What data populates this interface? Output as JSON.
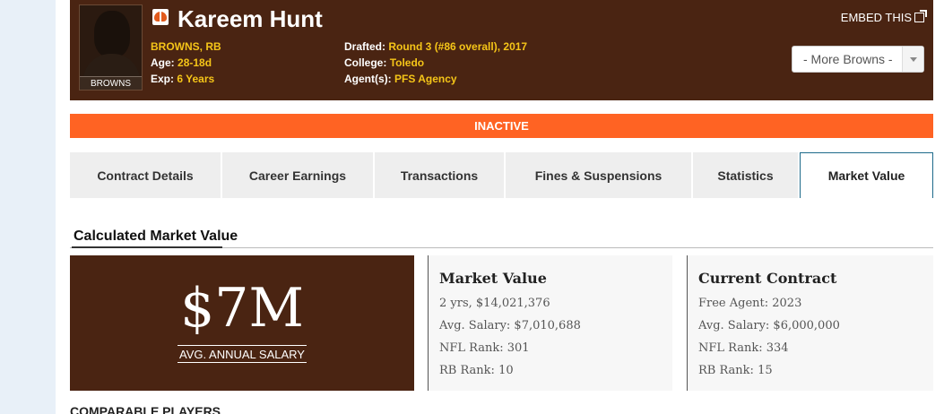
{
  "player": {
    "name": "Kareem Hunt",
    "photo_tag": "BROWNS",
    "team_position": "BROWNS, RB",
    "age_label": "Age:",
    "age_value": "28-18d",
    "exp_label": "Exp:",
    "exp_value": "6 Years",
    "drafted_label": "Drafted:",
    "drafted_value": "Round 3 (#86 overall), 2017",
    "college_label": "College:",
    "college_value": "Toledo",
    "agent_label": "Agent(s):",
    "agent_value": "PFS Agency"
  },
  "header": {
    "embed_label": "EMBED THIS",
    "dropdown_label": "- More Browns -"
  },
  "status": "INACTIVE",
  "tabs": [
    {
      "label": "Contract Details"
    },
    {
      "label": "Career Earnings"
    },
    {
      "label": "Transactions"
    },
    {
      "label": "Fines & Suspensions"
    },
    {
      "label": "Statistics"
    },
    {
      "label": "Market Value"
    }
  ],
  "section": {
    "title": "Calculated Market Value",
    "big_value": "$7M",
    "big_caption": "AVG. ANNUAL SALARY"
  },
  "market_value": {
    "title": "Market Value",
    "lines": [
      "2 yrs, $14,021,376",
      "Avg. Salary: $7,010,688",
      "NFL Rank: 301",
      "RB Rank: 10"
    ]
  },
  "current_contract": {
    "title": "Current Contract",
    "lines": [
      "Free Agent: 2023",
      "Avg. Salary: $6,000,000",
      "NFL Rank: 334",
      "RB Rank: 15"
    ]
  },
  "comparable_title": "COMPARABLE PLAYERS",
  "colors": {
    "brand_brown": "#4a2412",
    "status_orange": "#ff6323",
    "highlight_gold": "#f5c518"
  }
}
